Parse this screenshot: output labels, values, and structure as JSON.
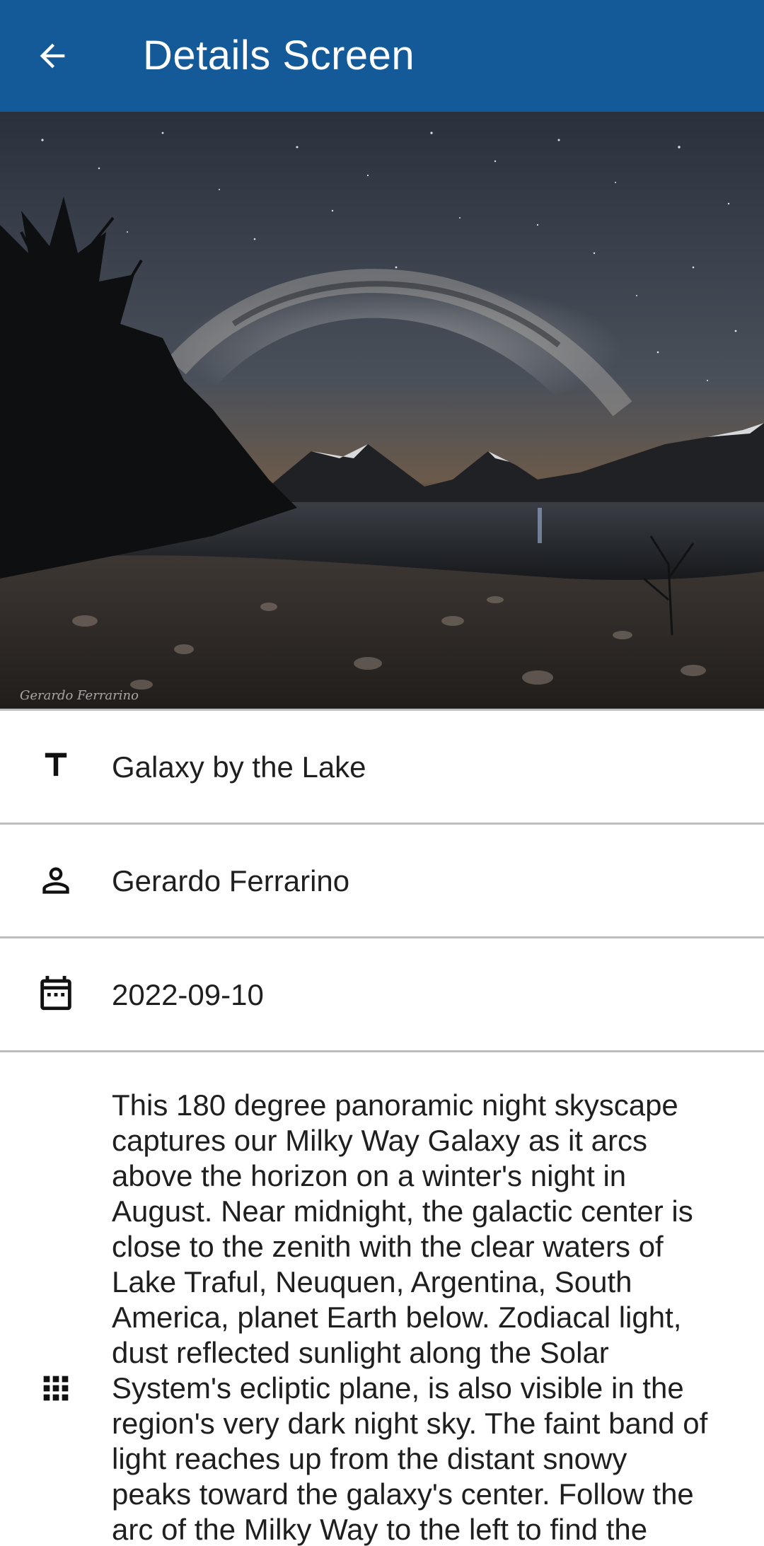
{
  "app_bar": {
    "title": "Details Screen",
    "back_icon": "arrow-back-icon"
  },
  "image": {
    "watermark": "Gerardo Ferrarino"
  },
  "details": {
    "title": {
      "icon": "text-icon",
      "value": "Galaxy by the Lake"
    },
    "author": {
      "icon": "person-icon",
      "value": "Gerardo Ferrarino"
    },
    "date": {
      "icon": "calendar-icon",
      "value": "2022-09-10"
    },
    "description": {
      "icon": "apps-grid-icon",
      "value": "This 180 degree panoramic night skyscape captures our Milky Way Galaxy as it arcs above the horizon on a winter's night in August. Near midnight, the galactic center is close to the zenith with the clear waters of Lake Traful, Neuquen, Argentina, South America, planet Earth below. Zodiacal light, dust reflected sunlight along the Solar System's ecliptic plane, is also visible in the region's very dark night sky. The faint band of light reaches up from the distant snowy peaks toward the galaxy's center. Follow the arc of the Milky Way to the left to find the"
    }
  }
}
